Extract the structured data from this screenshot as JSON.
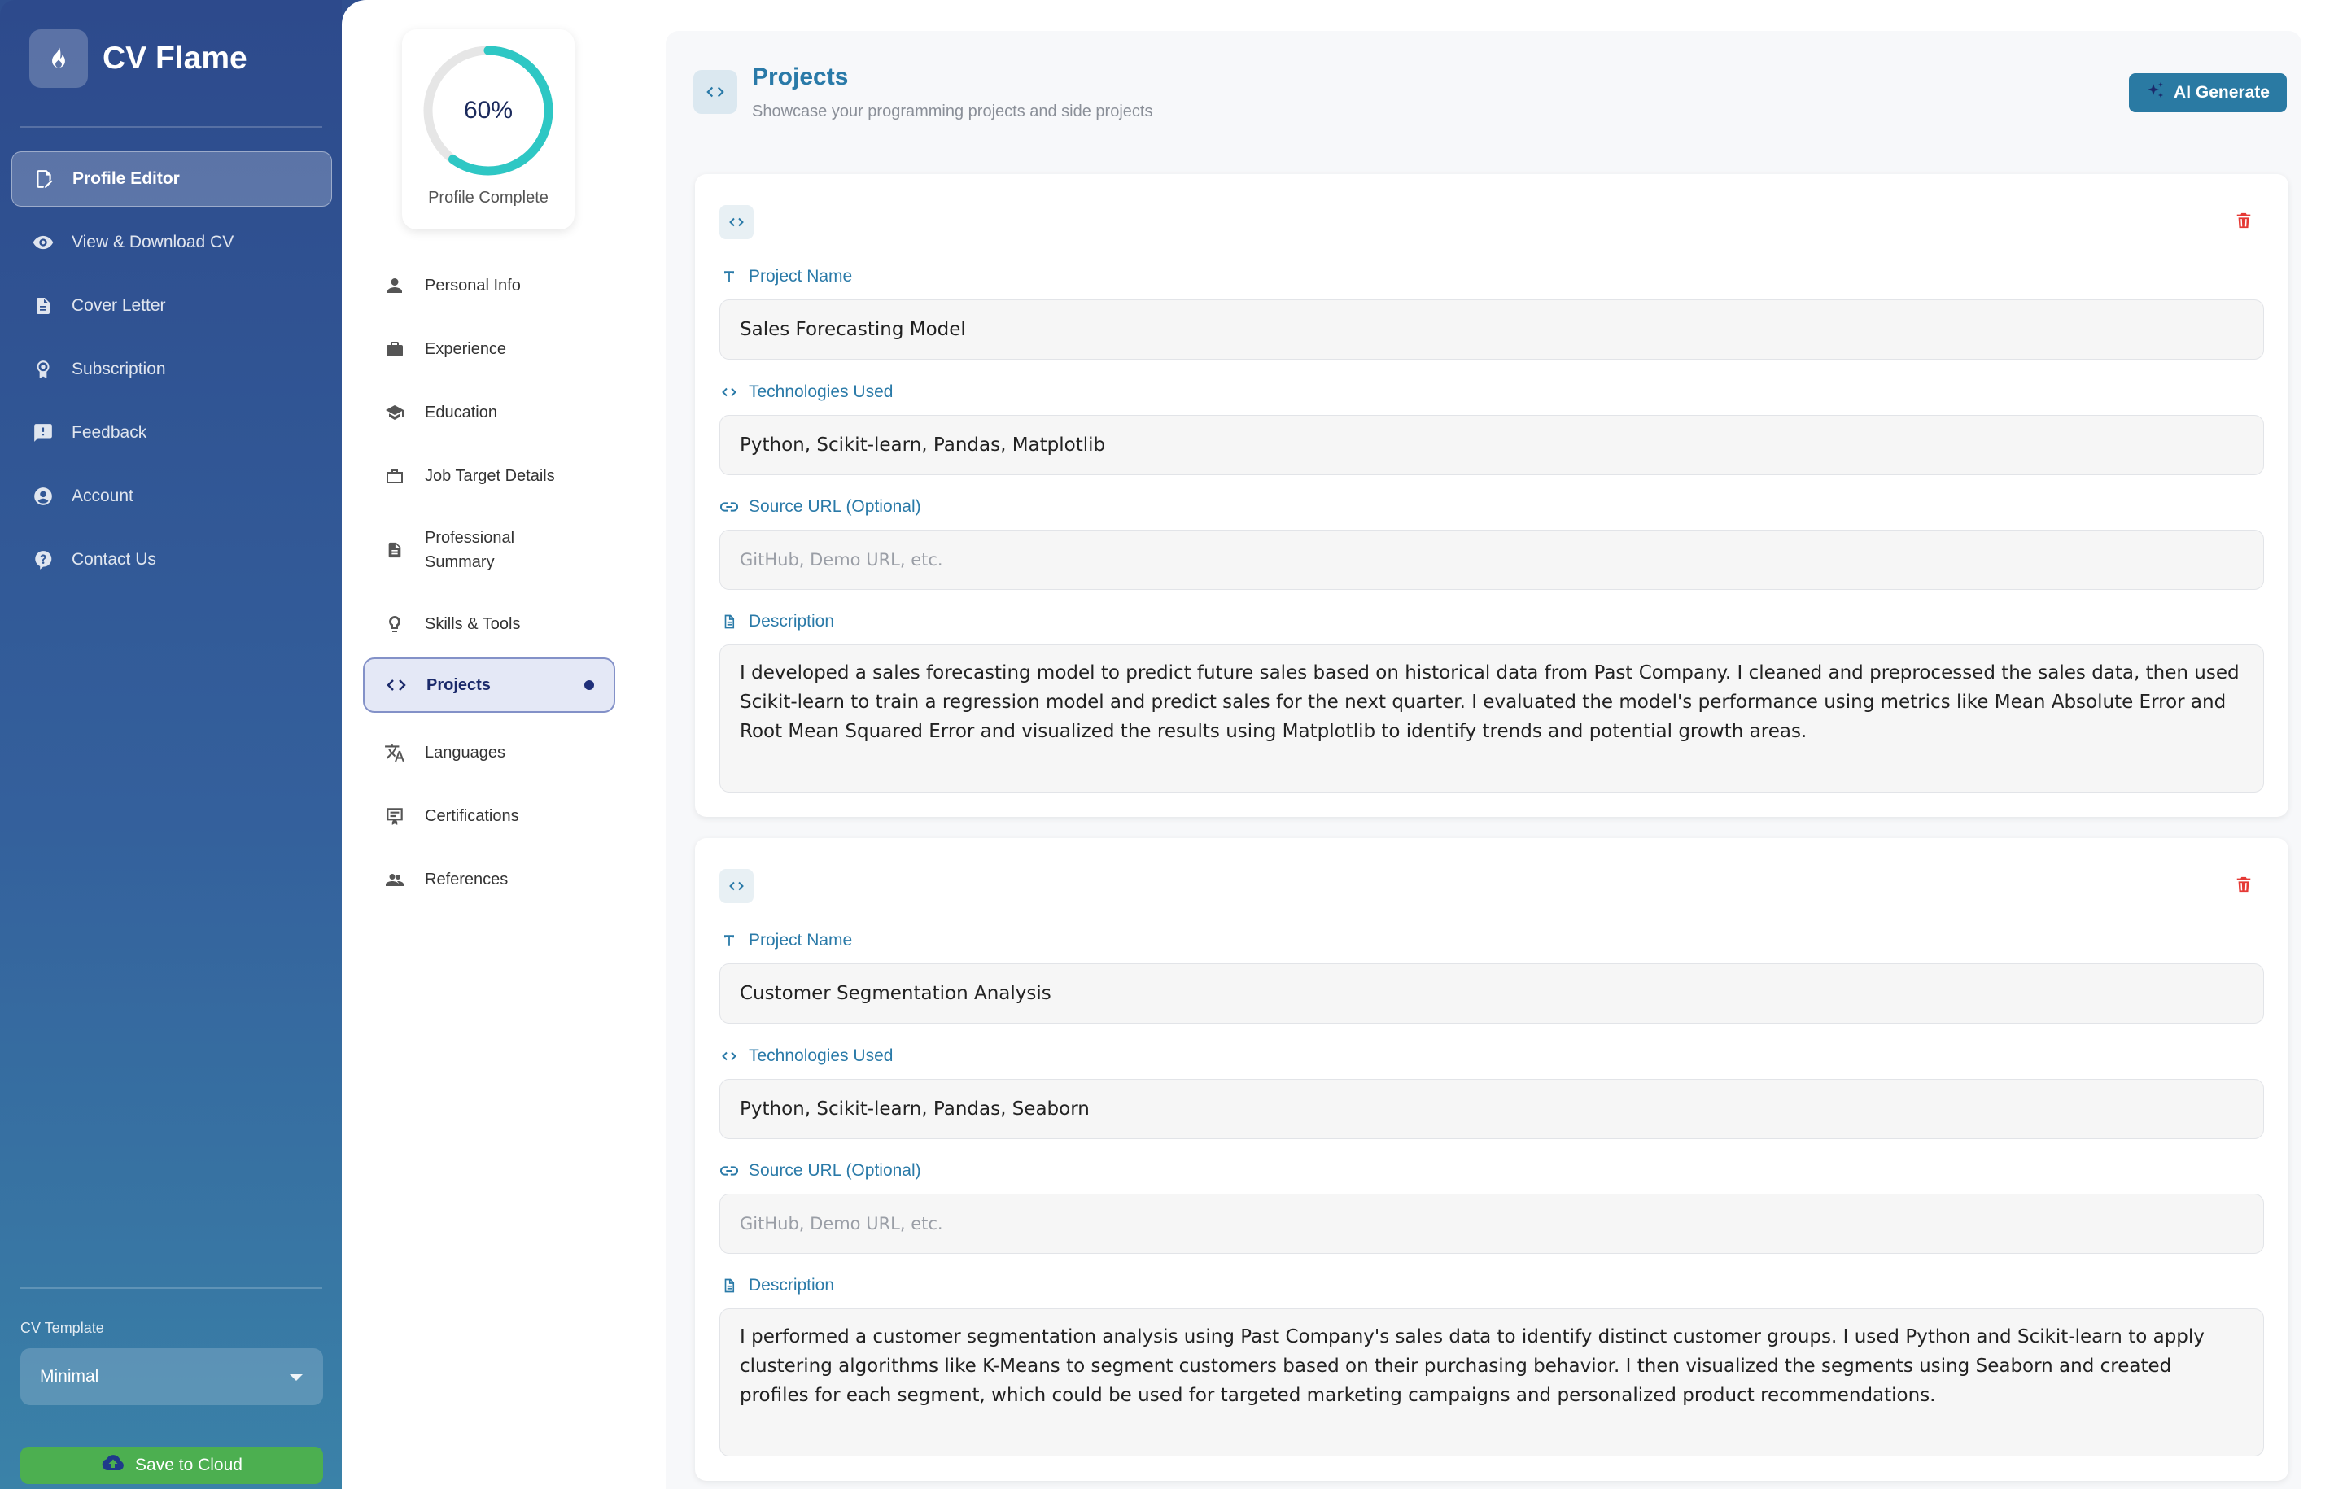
{
  "brand": {
    "name": "CV Flame"
  },
  "sidebar": {
    "items": [
      {
        "label": "Profile Editor",
        "icon": "edit-document-icon",
        "active": true
      },
      {
        "label": "View & Download CV",
        "icon": "eye-icon"
      },
      {
        "label": "Cover Letter",
        "icon": "document-icon"
      },
      {
        "label": "Subscription",
        "icon": "badge-icon"
      },
      {
        "label": "Feedback",
        "icon": "feedback-icon"
      },
      {
        "label": "Account",
        "icon": "account-icon"
      },
      {
        "label": "Contact Us",
        "icon": "help-icon"
      }
    ],
    "template_label": "CV Template",
    "template_value": "Minimal",
    "save_label": "Save to Cloud"
  },
  "progress": {
    "percent_label": "60%",
    "value": 60,
    "label": "Profile Complete"
  },
  "sections": [
    {
      "label": "Personal Info",
      "icon": "person-icon"
    },
    {
      "label": "Experience",
      "icon": "briefcase-icon"
    },
    {
      "label": "Education",
      "icon": "graduation-cap-icon"
    },
    {
      "label": "Job Target Details",
      "icon": "work-outline-icon"
    },
    {
      "label": "Professional Summary",
      "icon": "document-icon"
    },
    {
      "label": "Skills & Tools",
      "icon": "lightbulb-icon"
    },
    {
      "label": "Projects",
      "icon": "code-icon",
      "active": true
    },
    {
      "label": "Languages",
      "icon": "translate-icon"
    },
    {
      "label": "Certifications",
      "icon": "certificate-icon"
    },
    {
      "label": "References",
      "icon": "people-icon"
    }
  ],
  "content": {
    "title": "Projects",
    "subtitle": "Showcase your programming projects and side projects",
    "ai_button": "AI Generate",
    "labels": {
      "name": "Project Name",
      "tech": "Technologies Used",
      "url": "Source URL (Optional)",
      "desc": "Description"
    },
    "url_placeholder": "GitHub, Demo URL, etc.",
    "projects": [
      {
        "name": "Sales Forecasting Model",
        "tech": "Python, Scikit-learn, Pandas, Matplotlib",
        "url": "",
        "description": "I developed a sales forecasting model to predict future sales based on historical data from Past Company. I cleaned and preprocessed the sales data, then used Scikit-learn to train a regression model and predict sales for the next quarter. I evaluated the model's performance using metrics like Mean Absolute Error and Root Mean Squared Error and visualized the results using Matplotlib to identify trends and potential growth areas."
      },
      {
        "name": "Customer Segmentation Analysis",
        "tech": "Python, Scikit-learn, Pandas, Seaborn",
        "url": "",
        "description": "I performed a customer segmentation analysis using Past Company's sales data to identify distinct customer groups. I used Python and Scikit-learn to apply clustering algorithms like K-Means to segment customers based on their purchasing behavior. I then visualized the segments using Seaborn and created profiles for each segment, which could be used for targeted marketing campaigns and personalized product recommendations."
      }
    ]
  },
  "colors": {
    "accent": "#2a7aa8",
    "progress_ring": "#2ec7c4",
    "save_green": "#4caf50",
    "delete_red": "#e53935"
  }
}
